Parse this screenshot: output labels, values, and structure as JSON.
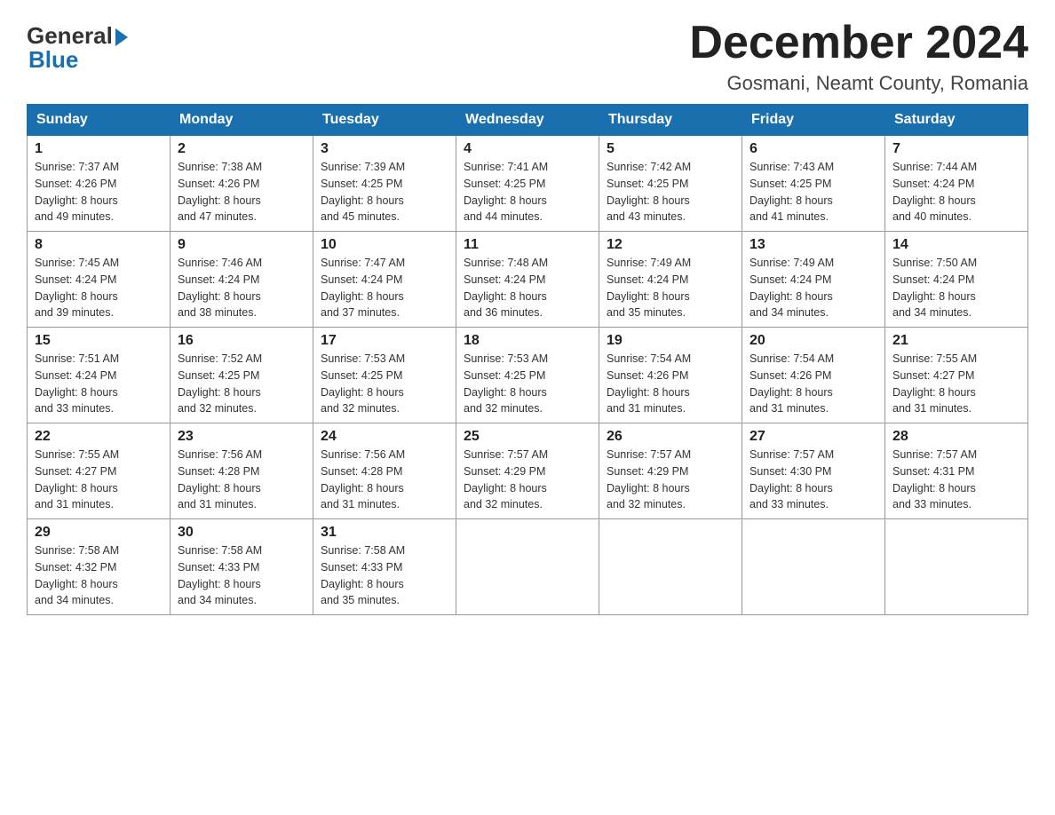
{
  "logo": {
    "general": "General",
    "blue": "Blue"
  },
  "header": {
    "month_year": "December 2024",
    "location": "Gosmani, Neamt County, Romania"
  },
  "days_of_week": [
    "Sunday",
    "Monday",
    "Tuesday",
    "Wednesday",
    "Thursday",
    "Friday",
    "Saturday"
  ],
  "weeks": [
    [
      {
        "day": "1",
        "sunrise": "7:37 AM",
        "sunset": "4:26 PM",
        "daylight": "8 hours and 49 minutes."
      },
      {
        "day": "2",
        "sunrise": "7:38 AM",
        "sunset": "4:26 PM",
        "daylight": "8 hours and 47 minutes."
      },
      {
        "day": "3",
        "sunrise": "7:39 AM",
        "sunset": "4:25 PM",
        "daylight": "8 hours and 45 minutes."
      },
      {
        "day": "4",
        "sunrise": "7:41 AM",
        "sunset": "4:25 PM",
        "daylight": "8 hours and 44 minutes."
      },
      {
        "day": "5",
        "sunrise": "7:42 AM",
        "sunset": "4:25 PM",
        "daylight": "8 hours and 43 minutes."
      },
      {
        "day": "6",
        "sunrise": "7:43 AM",
        "sunset": "4:25 PM",
        "daylight": "8 hours and 41 minutes."
      },
      {
        "day": "7",
        "sunrise": "7:44 AM",
        "sunset": "4:24 PM",
        "daylight": "8 hours and 40 minutes."
      }
    ],
    [
      {
        "day": "8",
        "sunrise": "7:45 AM",
        "sunset": "4:24 PM",
        "daylight": "8 hours and 39 minutes."
      },
      {
        "day": "9",
        "sunrise": "7:46 AM",
        "sunset": "4:24 PM",
        "daylight": "8 hours and 38 minutes."
      },
      {
        "day": "10",
        "sunrise": "7:47 AM",
        "sunset": "4:24 PM",
        "daylight": "8 hours and 37 minutes."
      },
      {
        "day": "11",
        "sunrise": "7:48 AM",
        "sunset": "4:24 PM",
        "daylight": "8 hours and 36 minutes."
      },
      {
        "day": "12",
        "sunrise": "7:49 AM",
        "sunset": "4:24 PM",
        "daylight": "8 hours and 35 minutes."
      },
      {
        "day": "13",
        "sunrise": "7:49 AM",
        "sunset": "4:24 PM",
        "daylight": "8 hours and 34 minutes."
      },
      {
        "day": "14",
        "sunrise": "7:50 AM",
        "sunset": "4:24 PM",
        "daylight": "8 hours and 34 minutes."
      }
    ],
    [
      {
        "day": "15",
        "sunrise": "7:51 AM",
        "sunset": "4:24 PM",
        "daylight": "8 hours and 33 minutes."
      },
      {
        "day": "16",
        "sunrise": "7:52 AM",
        "sunset": "4:25 PM",
        "daylight": "8 hours and 32 minutes."
      },
      {
        "day": "17",
        "sunrise": "7:53 AM",
        "sunset": "4:25 PM",
        "daylight": "8 hours and 32 minutes."
      },
      {
        "day": "18",
        "sunrise": "7:53 AM",
        "sunset": "4:25 PM",
        "daylight": "8 hours and 32 minutes."
      },
      {
        "day": "19",
        "sunrise": "7:54 AM",
        "sunset": "4:26 PM",
        "daylight": "8 hours and 31 minutes."
      },
      {
        "day": "20",
        "sunrise": "7:54 AM",
        "sunset": "4:26 PM",
        "daylight": "8 hours and 31 minutes."
      },
      {
        "day": "21",
        "sunrise": "7:55 AM",
        "sunset": "4:27 PM",
        "daylight": "8 hours and 31 minutes."
      }
    ],
    [
      {
        "day": "22",
        "sunrise": "7:55 AM",
        "sunset": "4:27 PM",
        "daylight": "8 hours and 31 minutes."
      },
      {
        "day": "23",
        "sunrise": "7:56 AM",
        "sunset": "4:28 PM",
        "daylight": "8 hours and 31 minutes."
      },
      {
        "day": "24",
        "sunrise": "7:56 AM",
        "sunset": "4:28 PM",
        "daylight": "8 hours and 31 minutes."
      },
      {
        "day": "25",
        "sunrise": "7:57 AM",
        "sunset": "4:29 PM",
        "daylight": "8 hours and 32 minutes."
      },
      {
        "day": "26",
        "sunrise": "7:57 AM",
        "sunset": "4:29 PM",
        "daylight": "8 hours and 32 minutes."
      },
      {
        "day": "27",
        "sunrise": "7:57 AM",
        "sunset": "4:30 PM",
        "daylight": "8 hours and 33 minutes."
      },
      {
        "day": "28",
        "sunrise": "7:57 AM",
        "sunset": "4:31 PM",
        "daylight": "8 hours and 33 minutes."
      }
    ],
    [
      {
        "day": "29",
        "sunrise": "7:58 AM",
        "sunset": "4:32 PM",
        "daylight": "8 hours and 34 minutes."
      },
      {
        "day": "30",
        "sunrise": "7:58 AM",
        "sunset": "4:33 PM",
        "daylight": "8 hours and 34 minutes."
      },
      {
        "day": "31",
        "sunrise": "7:58 AM",
        "sunset": "4:33 PM",
        "daylight": "8 hours and 35 minutes."
      },
      null,
      null,
      null,
      null
    ]
  ],
  "labels": {
    "sunrise": "Sunrise:",
    "sunset": "Sunset:",
    "daylight": "Daylight:"
  }
}
